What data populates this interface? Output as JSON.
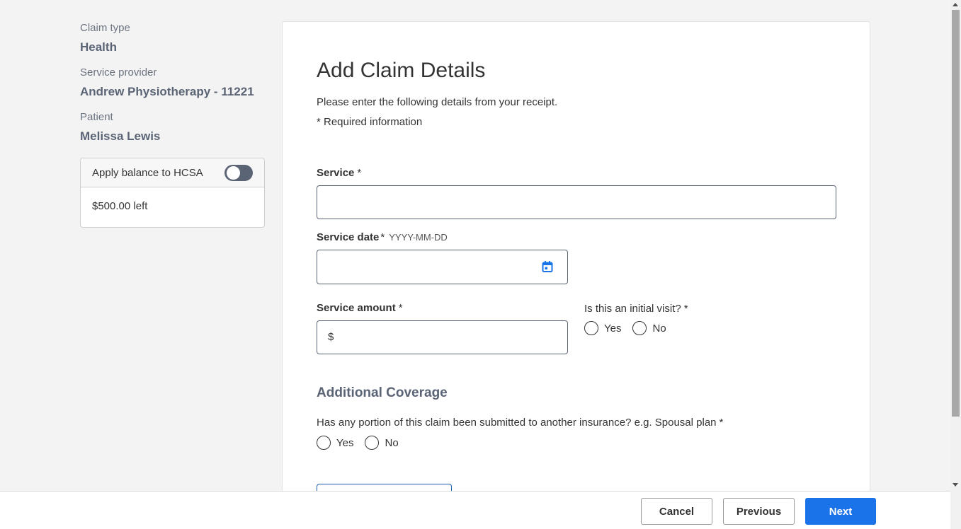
{
  "summary": {
    "claim_type_label": "Claim type",
    "claim_type_value": "Health",
    "provider_label": "Service provider",
    "provider_value": "Andrew Physiotherapy - 11221",
    "patient_label": "Patient",
    "patient_value": "Melissa Lewis"
  },
  "hcsa": {
    "label": "Apply balance to HCSA",
    "toggle_on": false,
    "balance": "$500.00 left"
  },
  "form": {
    "title": "Add Claim Details",
    "intro": "Please enter the following details from your receipt.",
    "required_note": "* Required information",
    "required_star": "*",
    "service_label": "Service",
    "service_value": "",
    "service_date_label": "Service date",
    "service_date_hint": "YYYY-MM-DD",
    "service_date_value": "",
    "service_amount_label": "Service amount",
    "currency_symbol": "$",
    "service_amount_value": "",
    "initial_visit_question": "Is this an initial visit?",
    "yes_label": "Yes",
    "no_label": "No",
    "additional_coverage_title": "Additional Coverage",
    "coverage_question": "Has any portion of this claim been submitted to another insurance? e.g. Spousal plan"
  },
  "footer": {
    "cancel_label": "Cancel",
    "previous_label": "Previous",
    "next_label": "Next"
  },
  "colors": {
    "accent": "#1a73e8",
    "label_slate": "#5b6475",
    "page_background": "#f3f3f3"
  },
  "icons": {
    "date_picker": "calendar-icon"
  }
}
